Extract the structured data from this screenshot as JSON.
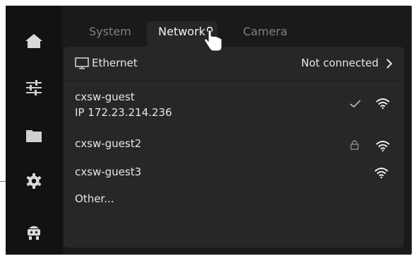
{
  "tabs": [
    {
      "label": "System"
    },
    {
      "label": "Network"
    },
    {
      "label": "Camera"
    }
  ],
  "sidebar": {
    "items": [
      {
        "icon": "home-icon"
      },
      {
        "icon": "sliders-icon"
      },
      {
        "icon": "folder-icon"
      },
      {
        "icon": "gear-icon"
      },
      {
        "icon": "robot-icon"
      }
    ]
  },
  "ethernet": {
    "label": "Ethernet",
    "status": "Not connected",
    "icon": "monitor-icon"
  },
  "networks": [
    {
      "ssid": "cxsw-guest",
      "ip": "IP  172.23.214.236",
      "connected": true,
      "locked": false
    },
    {
      "ssid": "cxsw-guest2",
      "connected": false,
      "locked": true
    },
    {
      "ssid": "cxsw-guest3",
      "connected": false,
      "locked": false
    }
  ],
  "other_label": "Other...",
  "colors": {
    "device_bg": "#1a1a1a",
    "sidebar_bg": "#121212",
    "panel_bg": "#272727",
    "text": "#e6e6e6",
    "muted_tab": "#808080"
  }
}
